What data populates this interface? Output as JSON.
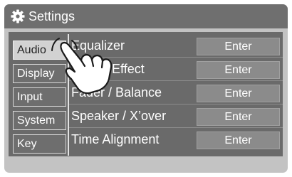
{
  "window": {
    "title": "Settings",
    "icon": "gear-icon"
  },
  "tabs": [
    {
      "label": "Audio",
      "active": true
    },
    {
      "label": "Display",
      "active": false
    },
    {
      "label": "Input",
      "active": false
    },
    {
      "label": "System",
      "active": false
    },
    {
      "label": "Key",
      "active": false
    }
  ],
  "settings": [
    {
      "label": "Equalizer",
      "button": "Enter"
    },
    {
      "label": "Sound Effect",
      "button": "Enter"
    },
    {
      "label": "Fader / Balance",
      "button": "Enter"
    },
    {
      "label": "Speaker / X’over",
      "button": "Enter"
    },
    {
      "label": "Time Alignment",
      "button": "Enter"
    }
  ],
  "overlay": {
    "icon": "pointing-hand-icon"
  },
  "colors": {
    "titlebar": "#6f6f6f",
    "panel": "#6a6a6a",
    "active_tab": "#d2d2d2",
    "button": "#8b8b8b"
  }
}
